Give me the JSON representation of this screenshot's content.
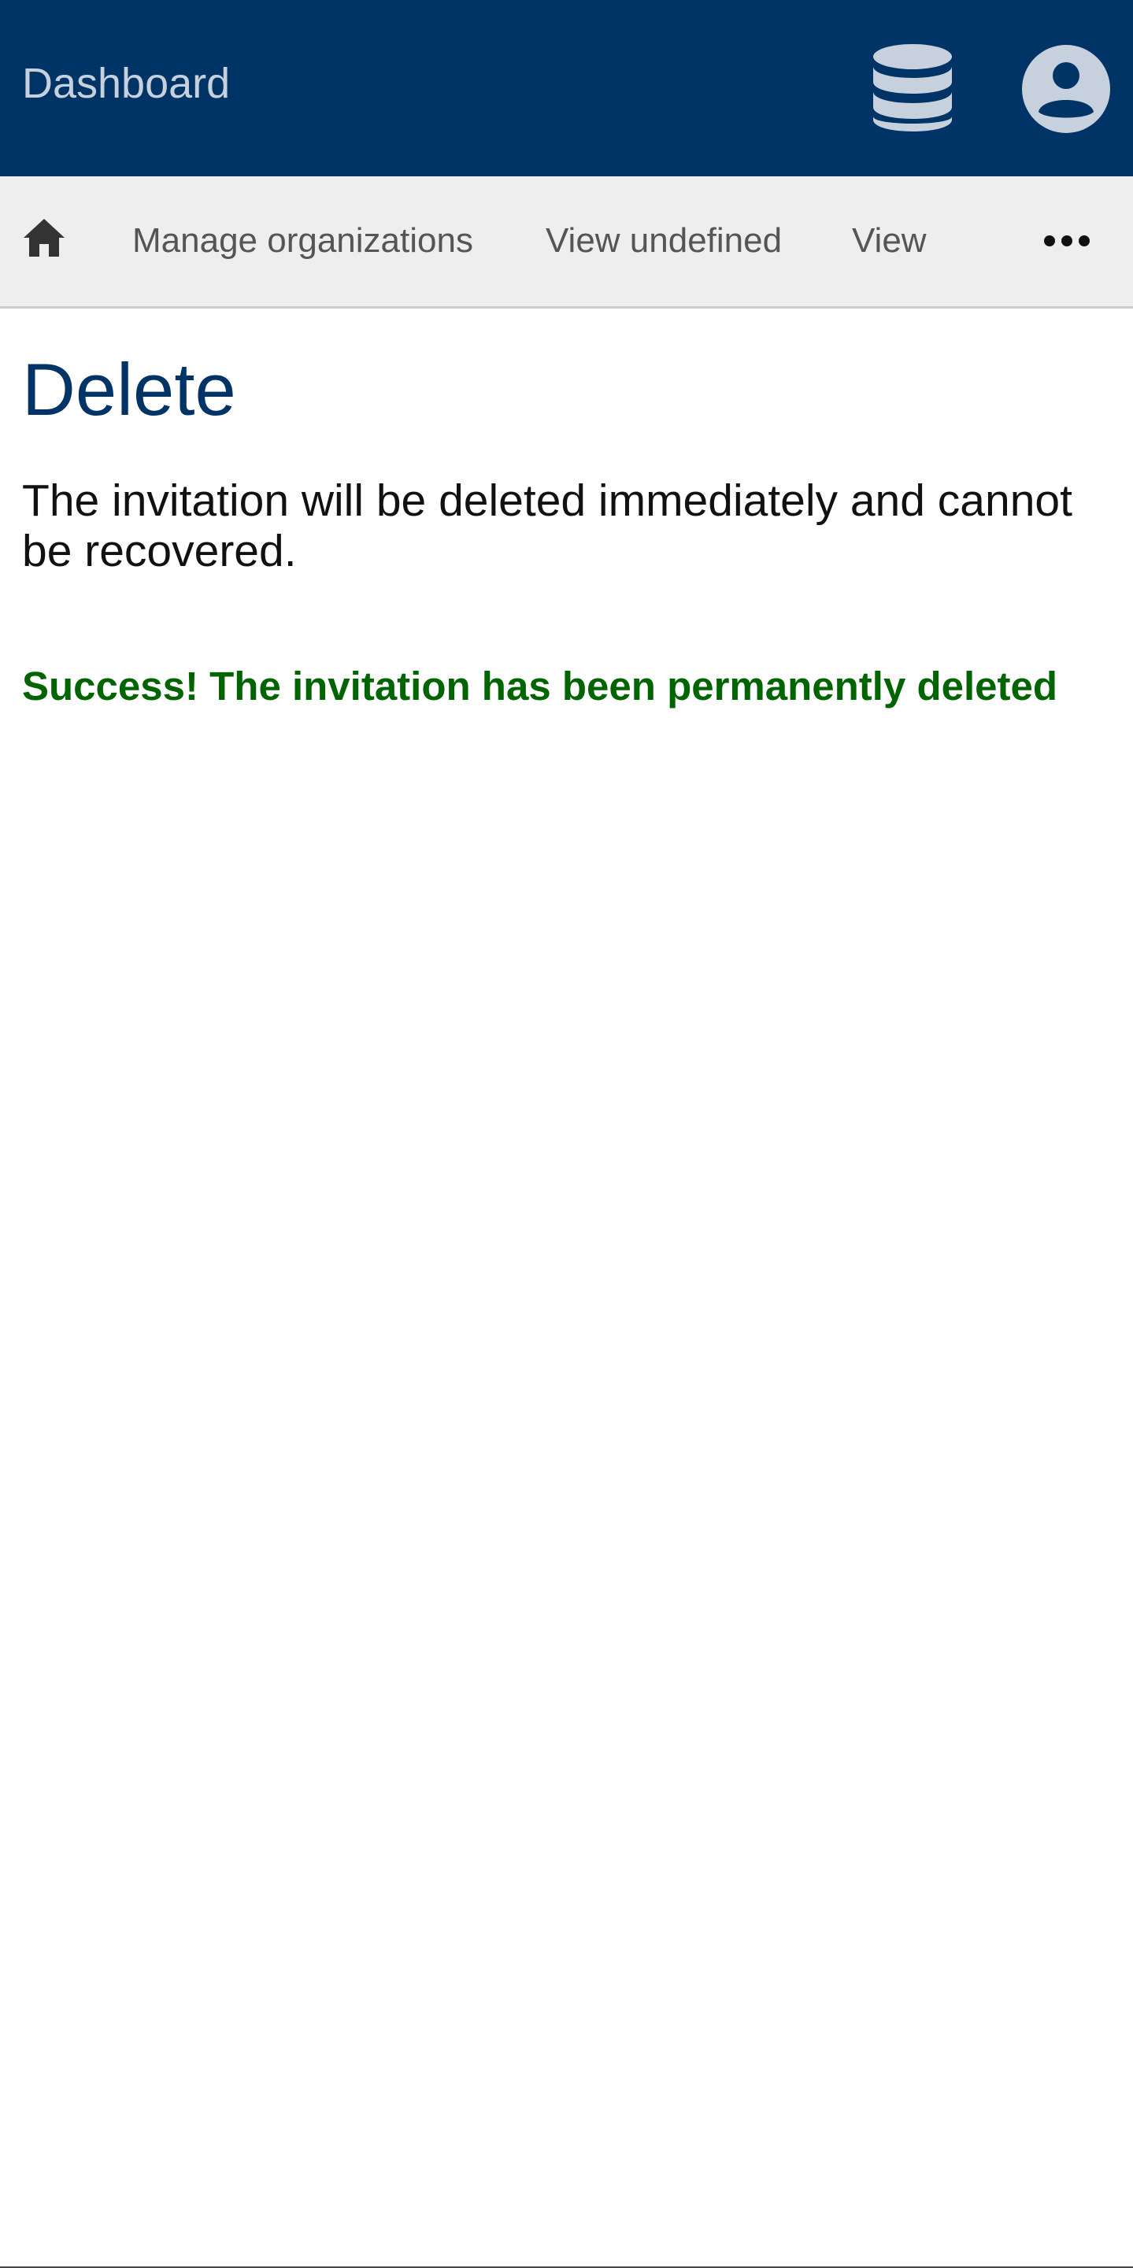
{
  "header": {
    "title": "Dashboard",
    "background_color": "#003366",
    "icons": [
      "database-icon",
      "user-account-icon"
    ]
  },
  "nav": {
    "home_icon": "home-icon",
    "items": [
      {
        "label": "Manage organizations"
      },
      {
        "label": "View undefined"
      },
      {
        "label": "View"
      }
    ],
    "more_icon": "more-horizontal-icon"
  },
  "main": {
    "title": "Delete",
    "description": "The invitation will be deleted immediately and cannot be recovered.",
    "success_message": "Success! The invitation has been permanently deleted"
  },
  "colors": {
    "brand": "#003366",
    "success": "#006400",
    "nav_background": "#eeeeee"
  }
}
